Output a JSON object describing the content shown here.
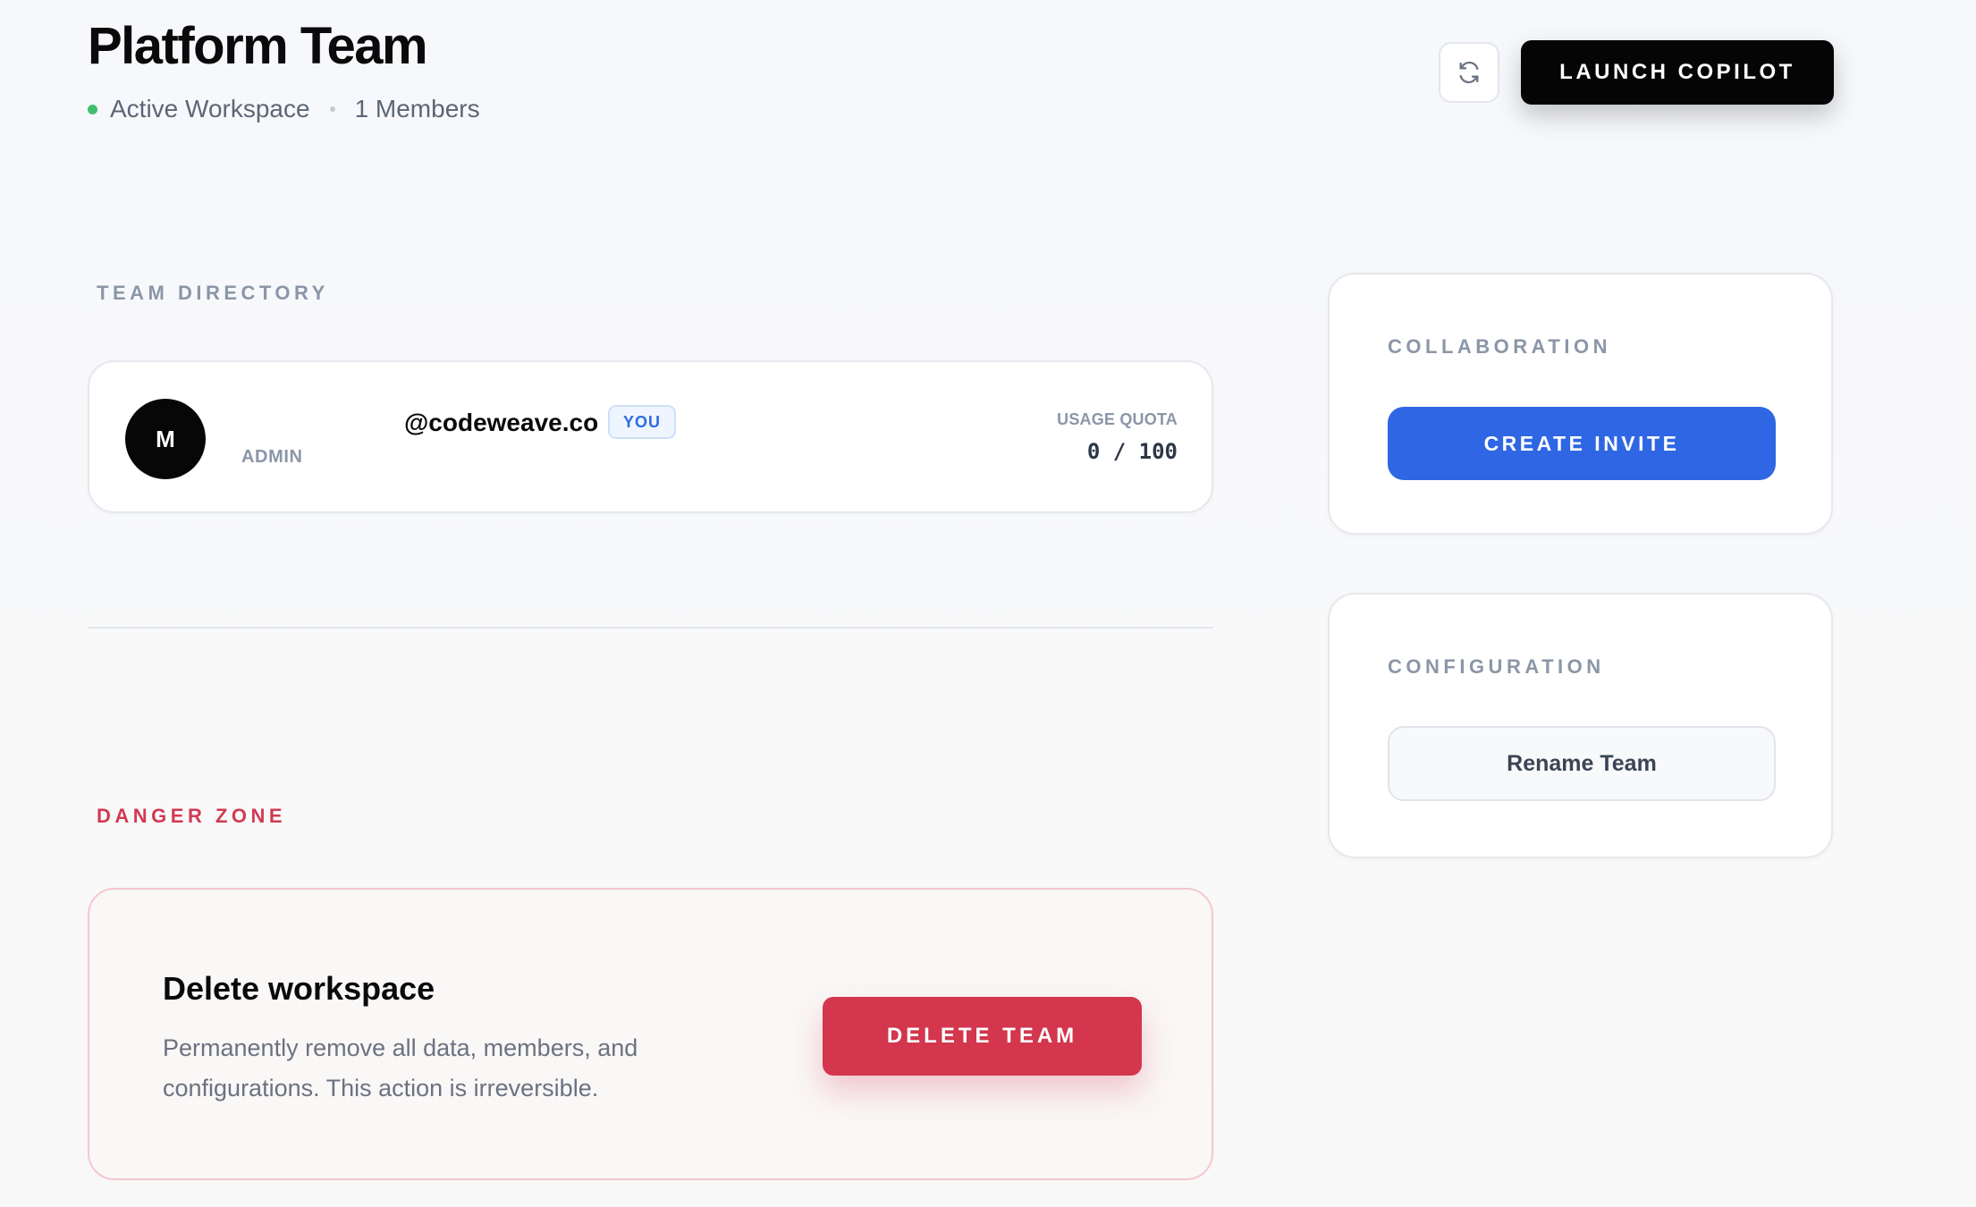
{
  "header": {
    "title": "Platform Team",
    "status": "Active Workspace",
    "members": "1 Members",
    "launch_label": "LAUNCH COPILOT",
    "refresh_icon": "refresh-icon"
  },
  "directory": {
    "label": "TEAM DIRECTORY",
    "member": {
      "initial": "M",
      "role": "ADMIN",
      "email": "@codeweave.co",
      "badge": "YOU",
      "quota_label": "USAGE QUOTA",
      "quota_value": "0 / 100"
    }
  },
  "danger": {
    "label": "DANGER ZONE",
    "title": "Delete workspace",
    "description": "Permanently remove all data, members, and configurations. This action is irreversible.",
    "button": "DELETE TEAM"
  },
  "collaboration": {
    "label": "COLLABORATION",
    "button": "CREATE INVITE"
  },
  "configuration": {
    "label": "CONFIGURATION",
    "button": "Rename Team"
  },
  "colors": {
    "accent_blue": "#2f66e3",
    "danger_red": "#d3364d",
    "status_green": "#3fbf6e",
    "black_button": "#050505"
  }
}
